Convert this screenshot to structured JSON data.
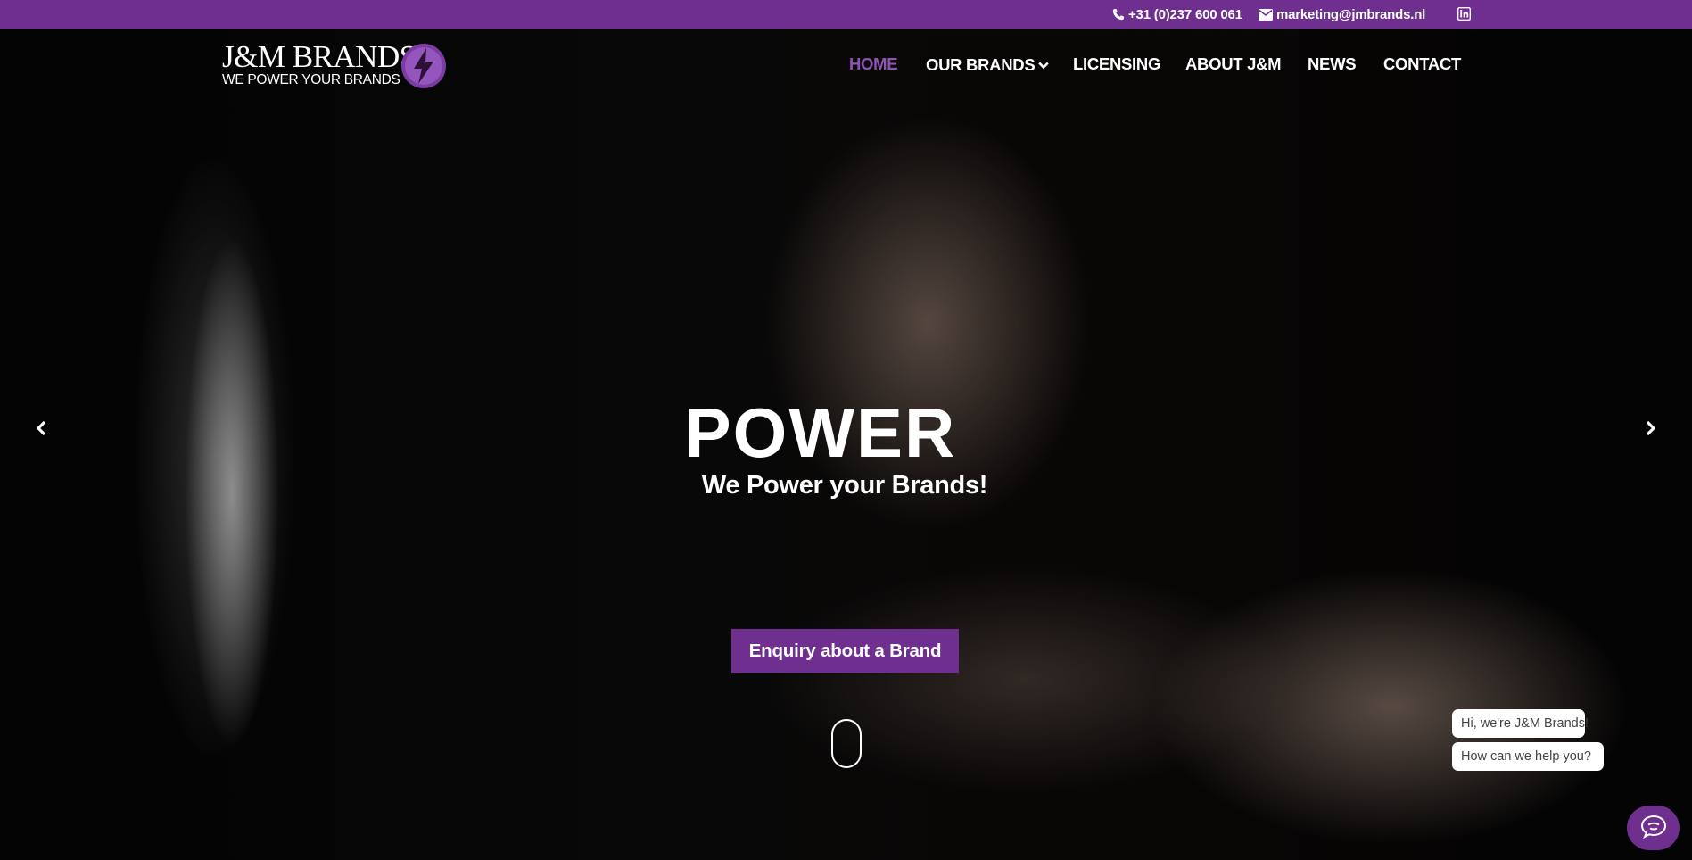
{
  "topbar": {
    "phone": "+31 (0)237 600 061",
    "email": "marketing@jmbrands.nl",
    "phone_icon": "phone-icon",
    "email_icon": "envelope-icon",
    "social_icon": "linkedin-icon",
    "background": "#6f2f8f"
  },
  "logo": {
    "wordmark": "J&M BRANDS",
    "tagline": "WE POWER YOUR BRANDS",
    "icon": "lightning-bolt-icon"
  },
  "nav": {
    "items": [
      {
        "label": "HOME",
        "active": true
      },
      {
        "label": "OUR BRANDS",
        "has_dropdown": true
      },
      {
        "label": "LICENSING"
      },
      {
        "label": "ABOUT J&M"
      },
      {
        "label": "NEWS"
      },
      {
        "label": "CONTACT"
      }
    ],
    "active_color": "#8e54b4"
  },
  "hero": {
    "title": "POWER",
    "subtitle": "We Power your Brands!",
    "cta_label": "Enquiry about a Brand",
    "prev_icon": "chevron-left-icon",
    "next_icon": "chevron-right-icon",
    "scroll_icon": "mouse-scroll-icon"
  },
  "chat": {
    "greeting": "Hi, we're J&M Brands!",
    "prompt": "How can we help you?",
    "launcher_icon": "chat-icon"
  },
  "colors": {
    "brand_purple": "#6f2f8f",
    "text_white": "#ffffff"
  }
}
